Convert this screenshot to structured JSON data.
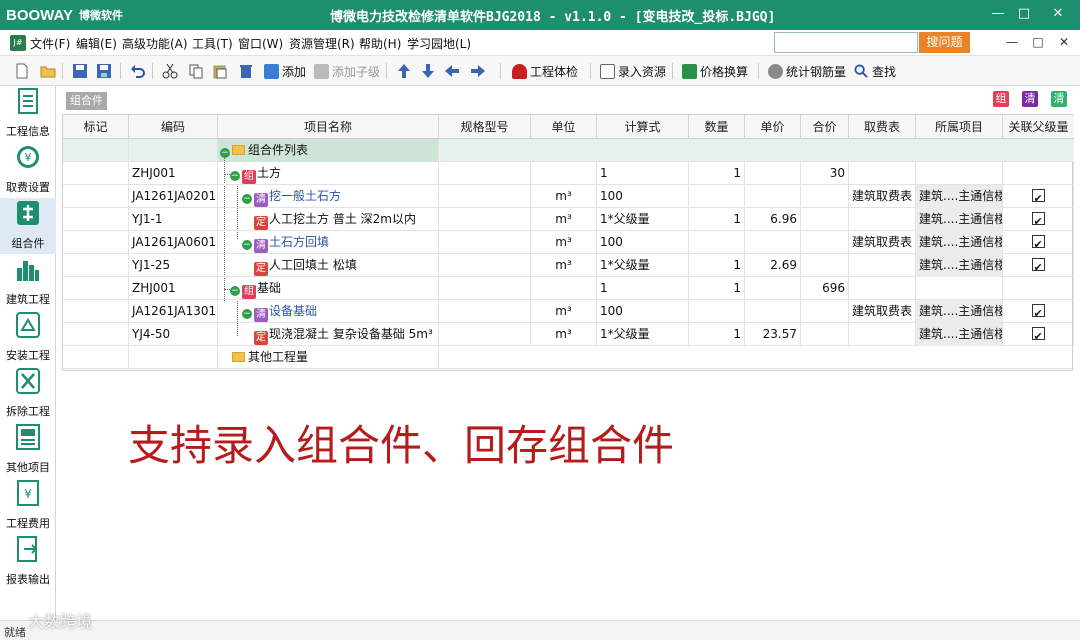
{
  "window": {
    "logo": "BOOWAY",
    "logo_cn": "博微软件",
    "title": "博微电力技改检修清单软件BJG2018 - v1.1.0 - [变电技改_投标.BJGQ]",
    "controls": {
      "minimize": "—",
      "maximize": "□",
      "close": "✕"
    }
  },
  "menu": {
    "app_icon": "J#",
    "items": [
      "文件(F)",
      "编辑(E)",
      "高级功能(A)",
      "工具(T)",
      "窗口(W)",
      "资源管理(R)",
      "帮助(H)",
      "学习园地(L)"
    ],
    "search_placeholder": "",
    "search_button": "搜问题",
    "mdi": {
      "minimize": "—",
      "restore": "□",
      "close": "✕"
    }
  },
  "toolbar": {
    "add": "添加",
    "add_child": "添加子级",
    "check": "工程体检",
    "input_resource": "录入资源",
    "price_convert": "价格换算",
    "rebar_stats": "统计钢筋量",
    "find": "查找"
  },
  "sidebar": [
    {
      "label": "工程信息",
      "icon": "document-list-icon"
    },
    {
      "label": "取费设置",
      "icon": "yuan-coin-icon"
    },
    {
      "label": "组合件",
      "icon": "assembly-icon"
    },
    {
      "label": "建筑工程",
      "icon": "building-icon"
    },
    {
      "label": "安装工程",
      "icon": "install-icon"
    },
    {
      "label": "拆除工程",
      "icon": "demolish-icon"
    },
    {
      "label": "其他项目",
      "icon": "other-items-icon"
    },
    {
      "label": "工程费用",
      "icon": "fee-icon"
    },
    {
      "label": "报表输出",
      "icon": "report-export-icon"
    }
  ],
  "panel": {
    "tab": "组合件",
    "badges": {
      "zu": "组",
      "qing": "清",
      "qing2": "清"
    },
    "badge_colors": {
      "zu": "#e0405a",
      "qing": "#7b2aa0",
      "qing2": "#2fb36a"
    }
  },
  "grid": {
    "headers": [
      "标记",
      "编码",
      "项目名称",
      "规格型号",
      "单位",
      "计算式",
      "数量",
      "单价",
      "合价",
      "取费表",
      "所属项目",
      "关联父级量"
    ],
    "root_label": "组合件列表",
    "rows": [
      {
        "code": "ZHJ001",
        "tag": "组",
        "name": "土方",
        "unit": "",
        "formula": "1",
        "qty": "1",
        "price": "",
        "total": "30",
        "fee": "",
        "project": "",
        "link": false
      },
      {
        "code": "JA1261JA0201",
        "tag": "清",
        "name": "挖一般土石方",
        "unit": "m³",
        "formula": "100",
        "qty": "",
        "price": "",
        "total": "",
        "fee": "建筑取费表",
        "project": "建筑....主通信楼",
        "link": true
      },
      {
        "code": "YJ1-1",
        "tag": "定",
        "name": "人工挖土方 普土 深2m以内",
        "unit": "m³",
        "formula": "1*父级量",
        "qty": "1",
        "price": "6.96",
        "total": "",
        "fee": "",
        "project": "建筑....主通信楼",
        "link": true
      },
      {
        "code": "JA1261JA0601",
        "tag": "清",
        "name": "土石方回填",
        "unit": "m³",
        "formula": "100",
        "qty": "",
        "price": "",
        "total": "",
        "fee": "建筑取费表",
        "project": "建筑....主通信楼",
        "link": true
      },
      {
        "code": "YJ1-25",
        "tag": "定",
        "name": "人工回填土 松填",
        "unit": "m³",
        "formula": "1*父级量",
        "qty": "1",
        "price": "2.69",
        "total": "",
        "fee": "",
        "project": "建筑....主通信楼",
        "link": true
      },
      {
        "code": "ZHJ001",
        "tag": "组",
        "name": "基础",
        "unit": "",
        "formula": "1",
        "qty": "1",
        "price": "",
        "total": "696",
        "fee": "",
        "project": "",
        "link": false
      },
      {
        "code": "JA1261JA1301",
        "tag": "清",
        "name": "设备基础",
        "unit": "m³",
        "formula": "100",
        "qty": "",
        "price": "",
        "total": "",
        "fee": "建筑取费表",
        "project": "建筑....主通信楼",
        "link": true
      },
      {
        "code": "YJ4-50",
        "tag": "定",
        "name": "现浇混凝土 复杂设备基础 5m³",
        "unit": "m³",
        "formula": "1*父级量",
        "qty": "1",
        "price": "23.57",
        "total": "",
        "fee": "",
        "project": "建筑....主通信楼",
        "link": true
      }
    ],
    "footer_label": "其他工程量"
  },
  "caption": "支持录入组合件、回存组合件",
  "status": "就绪",
  "watermark": "大数跨境"
}
